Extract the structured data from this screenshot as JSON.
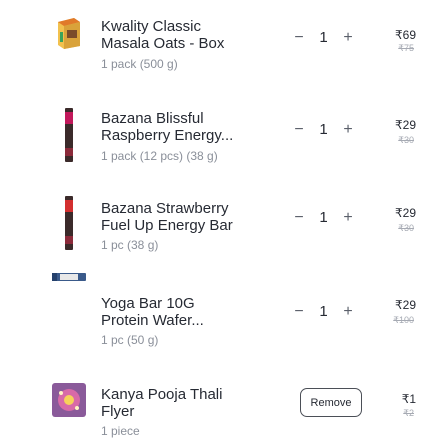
{
  "cart": {
    "items": [
      {
        "name_line1": "Kwality Classic",
        "name_line2": "Masala Oats - Box",
        "qty": "1 pack (500 g)",
        "minus": "−",
        "count": "1",
        "plus": "+",
        "price": "₹69",
        "mrp": "₹75",
        "thumb_icon": "oats-box-icon"
      },
      {
        "name_line1": "Bazana Blissful",
        "name_line2": "Raspberry Energy...",
        "qty": "1 pack (12 pcs) (38 g)",
        "minus": "−",
        "count": "1",
        "plus": "+",
        "price": "₹29",
        "mrp": "₹30",
        "thumb_icon": "energy-bar-icon"
      },
      {
        "name_line1": "Bazana Strawberry",
        "name_line2": "Fuel Up Energy Bar",
        "qty": "1 pc (38 g)",
        "minus": "−",
        "count": "1",
        "plus": "+",
        "price": "₹29",
        "mrp": "₹30",
        "thumb_icon": "energy-bar-icon"
      },
      {
        "name_line1": "Yoga Bar 10G",
        "name_line2": "Protein Wafer...",
        "qty": "1 pc (50 g)",
        "minus": "−",
        "count": "1",
        "plus": "+",
        "price": "₹29",
        "mrp": "₹100",
        "thumb_icon": "wafer-bar-icon"
      },
      {
        "name_line1": "Kanya Pooja Thali",
        "name_line2": "Flyer",
        "qty": "1 piece",
        "remove_label": "Remove",
        "price": "₹1",
        "mrp": "₹2",
        "thumb_icon": "flyer-icon"
      }
    ]
  }
}
